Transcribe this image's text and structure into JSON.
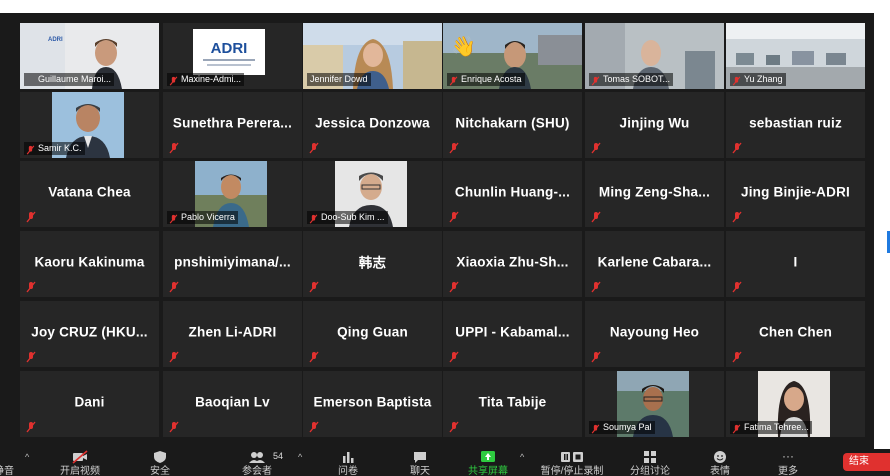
{
  "participants": {
    "row1": [
      {
        "label": "Guillaume Maroi..."
      },
      {
        "label": "Maxine-Admi...",
        "logo_text": "ADRI"
      },
      {
        "label": "Jennifer Dowd"
      },
      {
        "label": "Enrique Acosta"
      },
      {
        "label": "Tomas SOBOT..."
      },
      {
        "label": "Yu Zhang"
      }
    ],
    "row2": [
      {
        "label": "Samir K.C."
      },
      {
        "name": "Sunethra Perera..."
      },
      {
        "name": "Jessica Donzowa"
      },
      {
        "name": "Nitchakarn (SHU)"
      },
      {
        "name": "Jinjing Wu"
      },
      {
        "name": "sebastian ruiz"
      }
    ],
    "row3": [
      {
        "name": "Vatana Chea"
      },
      {
        "label": "Pablo Vicerra"
      },
      {
        "label": "Doo-Sub Kim ..."
      },
      {
        "name": "Chunlin Huang-..."
      },
      {
        "name": "Ming Zeng-Sha..."
      },
      {
        "name": "Jing Binjie-ADRI"
      }
    ],
    "row4": [
      {
        "name": "Kaoru Kakinuma"
      },
      {
        "name": "pnshimiyimana/..."
      },
      {
        "name": "韩志"
      },
      {
        "name": "Xiaoxia Zhu-Sh..."
      },
      {
        "name": "Karlene Cabara..."
      },
      {
        "name": "I"
      }
    ],
    "row5": [
      {
        "name": "Joy CRUZ (HKU..."
      },
      {
        "name": "Zhen Li-ADRI"
      },
      {
        "name": "Qing Guan"
      },
      {
        "name": "UPPI - Kabamal..."
      },
      {
        "name": "Nayoung Heo"
      },
      {
        "name": "Chen Chen"
      }
    ],
    "row6": [
      {
        "name": "Dani"
      },
      {
        "name": "Baoqian Lv"
      },
      {
        "name": "Emerson Baptista"
      },
      {
        "name": "Tita Tabije"
      },
      {
        "label": "Soumya Pal"
      },
      {
        "label": "Fatima Tehree..."
      }
    ]
  },
  "toolbar": {
    "mute_label": "静音",
    "video_label": "开启视频",
    "security_label": "安全",
    "participants_label": "参会者",
    "participants_count": "54",
    "polls_label": "问卷",
    "chat_label": "聊天",
    "share_label": "共享屏幕",
    "record_label": "暂停/停止录制",
    "breakout_label": "分组讨论",
    "reactions_label": "表情",
    "more_label": "更多",
    "more_glyph": "···",
    "end_label": "结束"
  },
  "colors": {
    "tile_bg": "#262626",
    "stage_bg": "#1a1a1a",
    "active_speaker": "#c7e23a",
    "muted_icon": "#e0312f",
    "share_green": "#2ecc40",
    "end_red": "#e0312f"
  }
}
